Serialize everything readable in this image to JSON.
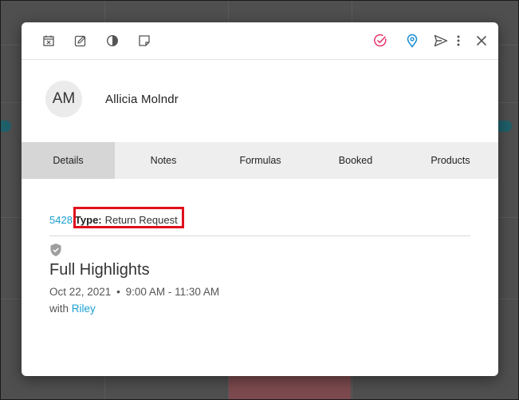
{
  "toolbar": {
    "left_icons": [
      "calendar-x-icon",
      "edit-icon",
      "contrast-icon",
      "note-icon"
    ],
    "right_icons": [
      "check-circle-icon",
      "location-pin-icon",
      "send-icon",
      "more-vert-icon",
      "close-icon"
    ],
    "accent_check": "#e8336b",
    "accent_pin": "#1a8fd1"
  },
  "contact": {
    "initials": "AM",
    "name": "Allicia Molndr"
  },
  "tabs": [
    {
      "label": "Details",
      "active": true
    },
    {
      "label": "Notes",
      "active": false
    },
    {
      "label": "Formulas",
      "active": false
    },
    {
      "label": "Booked",
      "active": false
    },
    {
      "label": "Products",
      "active": false
    }
  ],
  "details": {
    "id": "5428",
    "type_label": "Type:",
    "type_value": "Return Request",
    "title": "Full Highlights",
    "date": "Oct 22, 2021",
    "bullet": "•",
    "time": "9:00 AM - 11:30 AM",
    "with_prefix": "with",
    "with_name": "Riley"
  },
  "colors": {
    "link": "#1a9fd1",
    "highlight_box": "#e0101d",
    "active_tab": "#d6d6d6",
    "tab_bar": "#eeeeee"
  }
}
